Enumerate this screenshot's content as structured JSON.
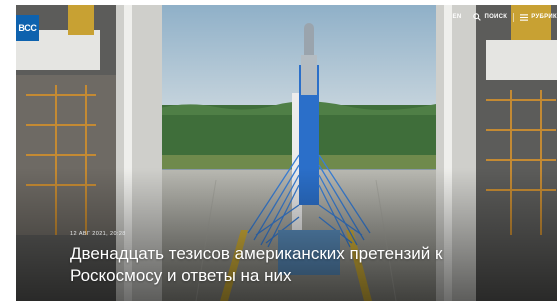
{
  "header": {
    "logo_text": "ВСС",
    "lang_label": "EN",
    "search_label": "ПОИСК",
    "rubrics_label": "РУБРИК",
    "icons": [
      "search-icon",
      "menu-icon"
    ]
  },
  "article": {
    "date": "12 АВГ 2021, 20:28",
    "title": "Двенадцать тезисов американских претензий к Роскосмосу и ответы на них"
  },
  "colors": {
    "brand": "#0e62ae",
    "sky": "#9ab4c8",
    "rocket": "#2b6fc9"
  }
}
